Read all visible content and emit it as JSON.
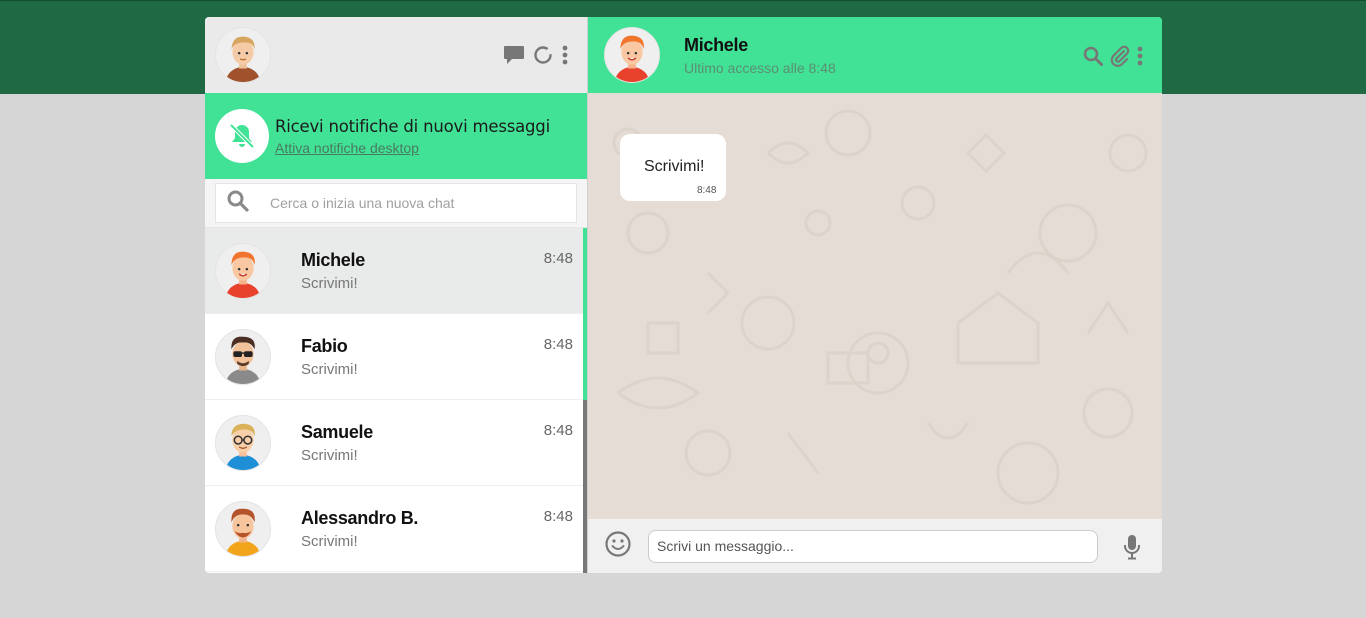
{
  "colors": {
    "accent": "#42e296",
    "topbar": "#1f6a44",
    "chat_bg": "#e5ddd5"
  },
  "icons": {
    "new_chat": "chat-bubble-icon",
    "status": "status-ring-icon",
    "menu": "kebab-menu-icon",
    "notifications": "bell-off-icon",
    "search": "search-icon",
    "attach": "paperclip-icon",
    "emoji": "emoji-icon",
    "mic": "microphone-icon"
  },
  "notification": {
    "title": "Ricevi notifiche di nuovi messaggi",
    "link": "Attiva notifiche desktop"
  },
  "search": {
    "placeholder": "Cerca o inizia una nuova chat"
  },
  "chats": [
    {
      "name": "Michele",
      "preview": "Scrivimi!",
      "time": "8:48"
    },
    {
      "name": "Fabio",
      "preview": "Scrivimi!",
      "time": "8:48"
    },
    {
      "name": "Samuele",
      "preview": "Scrivimi!",
      "time": "8:48"
    },
    {
      "name": "Alessandro B.",
      "preview": "Scrivimi!",
      "time": "8:48"
    }
  ],
  "conversation": {
    "contact_name": "Michele",
    "last_seen": "Ultimo accesso alle 8:48",
    "messages": [
      {
        "text": "Scrivimi!",
        "time": "8:48"
      }
    ]
  },
  "composer": {
    "placeholder": "Scrivi un messaggio..."
  }
}
